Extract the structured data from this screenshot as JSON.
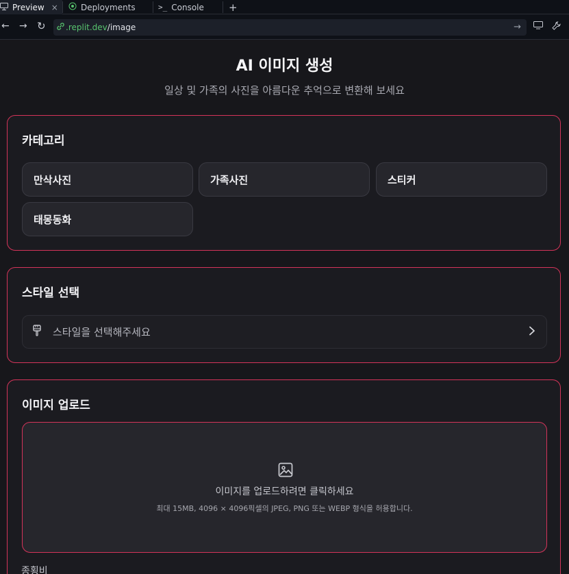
{
  "tabs": [
    {
      "label": "Preview",
      "icon": "monitor-icon",
      "active": true
    },
    {
      "label": "Deployments",
      "icon": "deploy-icon"
    },
    {
      "label": "Console",
      "icon": "terminal-icon"
    }
  ],
  "toolbar": {
    "close": "×",
    "plus": "+",
    "back": "←",
    "forward": "→",
    "reload": "↻",
    "url_host": ".replit.dev",
    "url_path": "/image",
    "go": "→"
  },
  "page": {
    "title": "AI 이미지 생성",
    "subtitle": "일상 및 가족의 사진을 아름다운 추억으로 변환해 보세요"
  },
  "category": {
    "heading": "카테고리",
    "items": [
      "만삭사진",
      "가족사진",
      "스티커",
      "태몽동화"
    ]
  },
  "style": {
    "heading": "스타일 선택",
    "placeholder": "스타일을 선택해주세요"
  },
  "upload": {
    "heading": "이미지 업로드",
    "prompt": "이미지를 업로드하려면 클릭하세요",
    "hint": "최대 15MB, 4096 × 4096픽셀의 JPEG, PNG 또는 WEBP 형식을 허용합니다."
  },
  "next_label": "종횡비",
  "colors": {
    "accent": "#d6345a",
    "background": "#17171b",
    "link": "#58c46e"
  }
}
